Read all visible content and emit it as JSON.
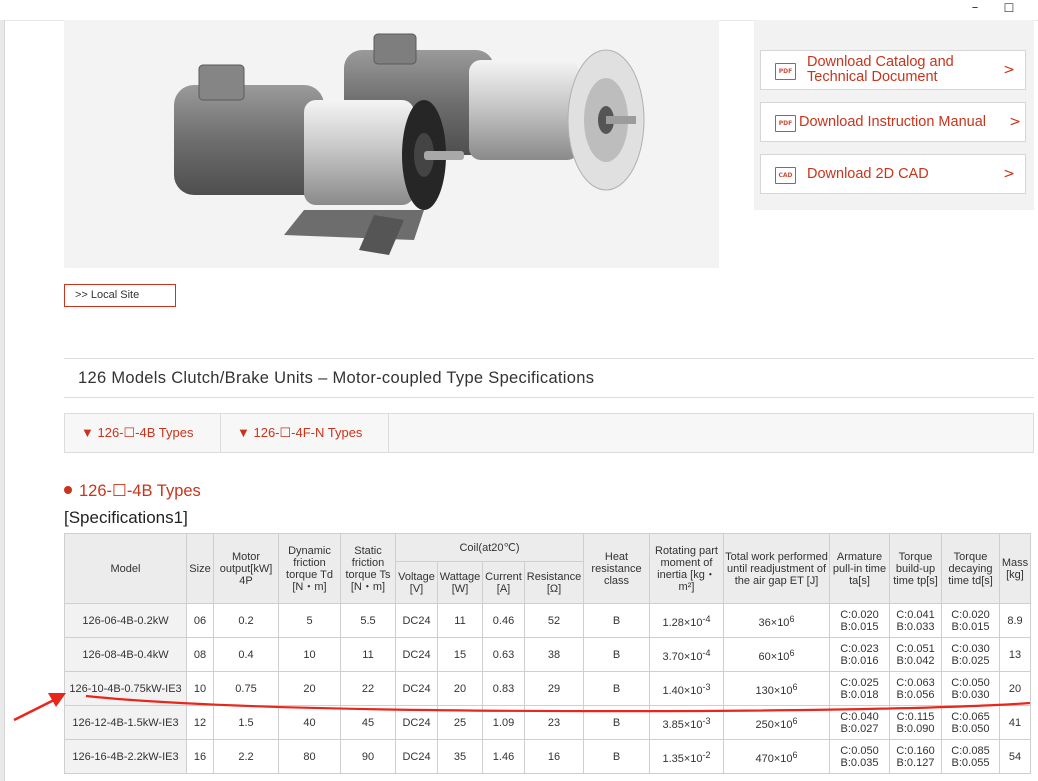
{
  "window": {
    "minimize_glyph": "–",
    "maximize_glyph": "☐"
  },
  "downloads": [
    {
      "icon": "pdf-icon",
      "icon_text": "PDF",
      "label": "Download Catalog and Technical Document",
      "chevron": ">"
    },
    {
      "icon": "pdf-icon",
      "icon_text": "PDF",
      "label": "Download Instruction Manual",
      "chevron": ">"
    },
    {
      "icon": "cad-icon",
      "icon_text": "CAD",
      "label": "Download 2D CAD",
      "chevron": ">"
    }
  ],
  "local_site": ">> Local Site",
  "section_title": "126 Models  Clutch/Brake Units – Motor-coupled Type Specifications",
  "tabs": [
    "▼ 126-☐-4B Types",
    "▼ 126-☐-4F-N Types"
  ],
  "subheading": "126-☐-4B Types",
  "spec_label": "[Specifications1]",
  "table": {
    "headers": {
      "model": "Model",
      "size": "Size",
      "motor_output": "Motor output[kW] 4P",
      "dynamic": "Dynamic friction torque Td [N・m]",
      "static": "Static friction torque Ts [N・m]",
      "coil": "Coil(at20℃)",
      "voltage": "Voltage [V]",
      "wattage": "Wattage [W]",
      "current": "Current [A]",
      "resistance": "Resistance [Ω]",
      "heat": "Heat resistance class",
      "inertia": "Rotating part moment of inertia [kg・m²]",
      "work": "Total work performed until readjustment of the air gap ET [J]",
      "armature": "Armature pull-in time ta[s]",
      "torque_up": "Torque build-up time tp[s]",
      "torque_down": "Torque decaying time td[s]",
      "mass": "Mass [kg]"
    },
    "rows": [
      {
        "model": "126-06-4B-0.2kW",
        "size": "06",
        "motor": "0.2",
        "td": "5",
        "ts": "5.5",
        "voltage": "DC24",
        "wattage": "11",
        "current": "0.46",
        "resistance": "52",
        "heat": "B",
        "inertia": "1.28×10",
        "inertia_exp": "-4",
        "work": "36×10",
        "work_exp": "6",
        "ta_c": "C:0.020",
        "ta_b": "B:0.015",
        "tp_c": "C:0.041",
        "tp_b": "B:0.033",
        "tdt_c": "C:0.020",
        "tdt_b": "B:0.015",
        "mass": "8.9"
      },
      {
        "model": "126-08-4B-0.4kW",
        "size": "08",
        "motor": "0.4",
        "td": "10",
        "ts": "11",
        "voltage": "DC24",
        "wattage": "15",
        "current": "0.63",
        "resistance": "38",
        "heat": "B",
        "inertia": "3.70×10",
        "inertia_exp": "-4",
        "work": "60×10",
        "work_exp": "6",
        "ta_c": "C:0.023",
        "ta_b": "B:0.016",
        "tp_c": "C:0.051",
        "tp_b": "B:0.042",
        "tdt_c": "C:0.030",
        "tdt_b": "B:0.025",
        "mass": "13"
      },
      {
        "model": "126-10-4B-0.75kW-IE3",
        "size": "10",
        "motor": "0.75",
        "td": "20",
        "ts": "22",
        "voltage": "DC24",
        "wattage": "20",
        "current": "0.83",
        "resistance": "29",
        "heat": "B",
        "inertia": "1.40×10",
        "inertia_exp": "-3",
        "work": "130×10",
        "work_exp": "6",
        "ta_c": "C:0.025",
        "ta_b": "B:0.018",
        "tp_c": "C:0.063",
        "tp_b": "B:0.056",
        "tdt_c": "C:0.050",
        "tdt_b": "B:0.030",
        "mass": "20"
      },
      {
        "model": "126-12-4B-1.5kW-IE3",
        "size": "12",
        "motor": "1.5",
        "td": "40",
        "ts": "45",
        "voltage": "DC24",
        "wattage": "25",
        "current": "1.09",
        "resistance": "23",
        "heat": "B",
        "inertia": "3.85×10",
        "inertia_exp": "-3",
        "work": "250×10",
        "work_exp": "6",
        "ta_c": "C:0.040",
        "ta_b": "B:0.027",
        "tp_c": "C:0.115",
        "tp_b": "B:0.090",
        "tdt_c": "C:0.065",
        "tdt_b": "B:0.050",
        "mass": "41"
      },
      {
        "model": "126-16-4B-2.2kW-IE3",
        "size": "16",
        "motor": "2.2",
        "td": "80",
        "ts": "90",
        "voltage": "DC24",
        "wattage": "35",
        "current": "1.46",
        "resistance": "16",
        "heat": "B",
        "inertia": "1.35×10",
        "inertia_exp": "-2",
        "work": "470×10",
        "work_exp": "6",
        "ta_c": "C:0.050",
        "ta_b": "B:0.035",
        "tp_c": "C:0.160",
        "tp_b": "B:0.127",
        "tdt_c": "C:0.085",
        "tdt_b": "B:0.055",
        "mass": "54"
      }
    ]
  },
  "colors": {
    "accent": "#c9341c",
    "annotation": "#e8261c"
  }
}
